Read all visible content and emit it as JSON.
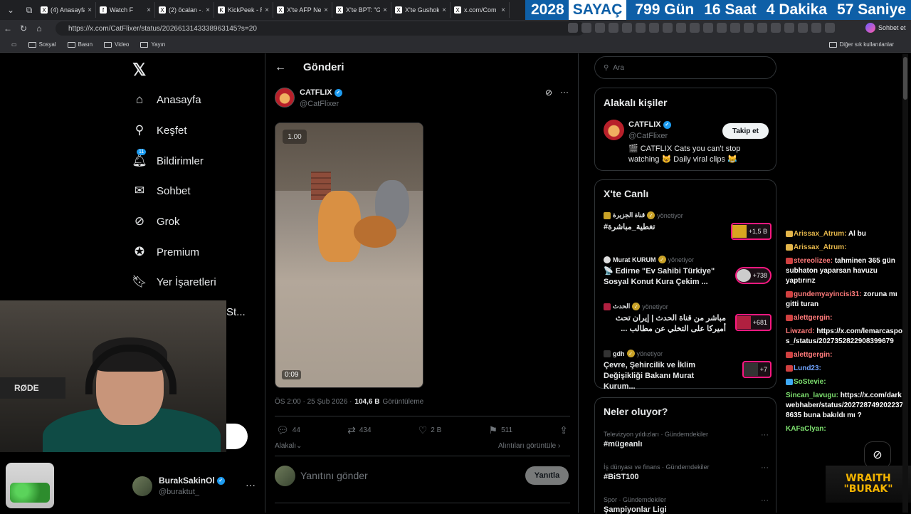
{
  "browser": {
    "tabs": [
      {
        "title": "(4) Anasayfa",
        "icon": "X"
      },
      {
        "title": "Watch F",
        "icon": "f"
      },
      {
        "title": "(2) öcalan - A",
        "icon": "X"
      },
      {
        "title": "KickPeek - R",
        "icon": "K"
      },
      {
        "title": "X'te AFP Nev",
        "icon": "X"
      },
      {
        "title": "X'te BPT: \"G",
        "icon": "X"
      },
      {
        "title": "X'te Gushok",
        "icon": "X"
      },
      {
        "title": "x.com/Com",
        "icon": "X"
      }
    ],
    "counter": {
      "year": "2028",
      "label": "SAYAÇ",
      "days": "799 Gün",
      "hours": "16 Saat",
      "minutes": "4 Dakika",
      "seconds": "57 Saniye"
    },
    "url": "https://x.com/CatFlixer/status/2026613143338963145?s=20",
    "chat_ext": "Sohbet et",
    "bookmarks": [
      "Sosyal",
      "Basın",
      "Video",
      "Yayın"
    ],
    "other_bookmarks": "Diğer sık kullanılanlar"
  },
  "sidebar": {
    "items": [
      {
        "label": "Anasayfa",
        "icon": "home-icon"
      },
      {
        "label": "Keşfet",
        "icon": "search-icon"
      },
      {
        "label": "Bildirimler",
        "icon": "bell-icon",
        "badge": "11"
      },
      {
        "label": "Sohbet",
        "icon": "mail-icon"
      },
      {
        "label": "Grok",
        "icon": "grok-icon"
      },
      {
        "label": "Premium",
        "icon": "premium-icon"
      },
      {
        "label": "Yer İşaretleri",
        "icon": "bookmark-icon"
      }
    ],
    "partial_label": "St...",
    "account": {
      "name": "BurakSakinOl",
      "handle": "@buraktut_"
    }
  },
  "webcam": {
    "mic_label": "RØDE"
  },
  "post": {
    "header_title": "Gönderi",
    "author_name": "CATFLIX",
    "author_handle": "@CatFlixer",
    "video_speed": "1.00",
    "video_time": "0:09",
    "timestamp": "ÖS 2:00 · 25 Şub 2026 ·",
    "views_value": "104,6 B",
    "views_label": "Görüntüleme",
    "replies": "44",
    "reposts": "434",
    "likes": "2 B",
    "bookmarks": "511",
    "sort_label": "Alakalı",
    "quotes_label": "Alıntıları görüntüle",
    "reply_placeholder": "Yanıtını gönder",
    "reply_button": "Yanıtla"
  },
  "right": {
    "search_placeholder": "Ara",
    "related": {
      "title": "Alakalı kişiler",
      "name": "CATFLIX",
      "handle": "@CatFlixer",
      "bio": "🎬 CATFLIX Cats you can't stop watching 😺 Daily viral clips 😹",
      "follow": "Takip et"
    },
    "live": {
      "title": "X'te Canlı",
      "items": [
        {
          "source": "قناة الجزيرة",
          "status": "yönetiyor",
          "title": "تغطية_مباشرة#",
          "count": "+1,5 B"
        },
        {
          "source": "Murat KURUM",
          "status": "yönetiyor",
          "title": "📡 Edirne \"Ev Sahibi Türkiye\" Sosyal Konut Kura Çekim ...",
          "count": "+738"
        },
        {
          "source": "الحدث",
          "status": "yönetiyor",
          "title": "مباشر من قناة الحدث | إيران تحث أميركا على التخلي عن مطالب ...",
          "count": "+681"
        },
        {
          "source": "gdh",
          "status": "yönetiyor",
          "title": "Çevre, Şehircilik ve İklim Değişikliği Bakanı Murat Kurum...",
          "count": "+7"
        }
      ]
    },
    "whats": {
      "title": "Neler oluyor?",
      "items": [
        {
          "category": "Televizyon yıldızları · Gündemdekiler",
          "name": "#mügeanlı"
        },
        {
          "category": "İş dünyası ve finans · Gündemdekiler",
          "name": "#BiST100"
        },
        {
          "category": "Spor · Gündemdekiler",
          "name": "Şampiyonlar Ligi"
        }
      ]
    }
  },
  "chat": {
    "messages": [
      {
        "user": "Arissax_Atrum:",
        "text": "Al bu"
      },
      {
        "user": "Arissax_Atrum:",
        "text": ""
      },
      {
        "user": "stereolizee:",
        "text": "tahminen 365 gün subhaton yaparsan havuzu yaptırırız"
      },
      {
        "user": "gundemyayincisi31:",
        "text": "zoruna mı gitti turan"
      },
      {
        "user": "alettgergin:",
        "text": ""
      },
      {
        "user": "Liwzard:",
        "text": "https://x.com/lemarcaspors_/status/2027352822908399679"
      },
      {
        "user": "alettgergin:",
        "text": ""
      },
      {
        "user": "Lund23:",
        "text": ""
      },
      {
        "user": "SoStevie:",
        "text": ""
      },
      {
        "user": "Sincan_lavugu:",
        "text": "https://x.com/darkwebhaber/status/2027287492022378635 buna bakıldı mı ?"
      },
      {
        "user": "KAFaClyan:",
        "text": ""
      }
    ],
    "overlay_top": "WRAITH",
    "overlay_bottom": "\"BURAK\""
  }
}
